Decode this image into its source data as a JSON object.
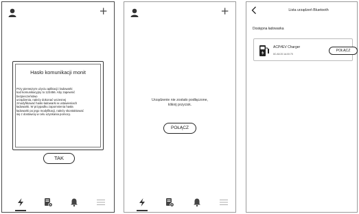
{
  "screen1": {
    "add_symbol": "+",
    "modal": {
      "title": "Hasło komunikacji monit",
      "body": "Przy pierwszym użyciu aplikacji i ładowarki\nkod komunikacyjny to 123456. Aby zapewnić\nbezpieczeństwo\nurządzenia, należy dokonać wczesnej\nzmodyfikować hasło ładowarki w ustawieniach\nładowarki. W przypadku zapomnienia hasła\nładowarki po jego modyfikacji, należy skontaktować\nsię z dostawcą w celu uzyskania pomocy.",
      "ok_label": "TAK"
    }
  },
  "screen2": {
    "add_symbol": "+",
    "message": "Urządzenie nie zostało podłączone,\nkliknij przycisk.",
    "connect_label": "POŁĄCZ"
  },
  "screen3": {
    "header_title": "Lista urządzeń Bluetooth",
    "section_label": "Dostępna ładowarka",
    "device": {
      "name": "ACP#EV Charger",
      "mac": "8C:A5:20:1A:00:75",
      "connect_label": "POŁĄCZ"
    }
  },
  "tabbar": {
    "icons": [
      "lightning-icon",
      "document-settings-icon",
      "bell-icon",
      "menu-icon"
    ],
    "active_tab": "lightning-icon"
  }
}
